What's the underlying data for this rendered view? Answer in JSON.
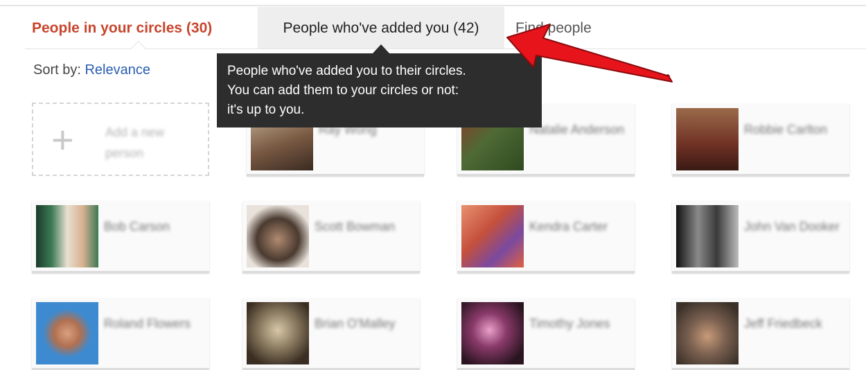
{
  "tabs": [
    {
      "label": "People in your circles (30)"
    },
    {
      "label": "People who've added you (42)"
    },
    {
      "label": "Find people"
    }
  ],
  "sort": {
    "label": "Sort by:",
    "value": "Relevance"
  },
  "tooltip": {
    "line1": "People who've added you to their circles.",
    "line2": "You can add them to your circles or not:",
    "line3": "it's up to you."
  },
  "add_person": {
    "label": "Add a new person"
  },
  "people": [
    {
      "name": "Ray Wong",
      "avatar_color": "#7a5a43"
    },
    {
      "name": "Natalie Anderson",
      "avatar_color": "#4f6a35"
    },
    {
      "name": "Robbie Carlton",
      "avatar_color": "#6e3024"
    },
    {
      "name": "Bob Carson",
      "avatar_color": "#3d7a55"
    },
    {
      "name": "Scott Bowman",
      "avatar_color": "#4a3a30"
    },
    {
      "name": "Kendra Carter",
      "avatar_color": "#c5503c"
    },
    {
      "name": "John Van Dooker",
      "avatar_color": "#3a3a3a"
    },
    {
      "name": "Roland Flowers",
      "avatar_color": "#3d8ad0"
    },
    {
      "name": "Brian O'Malley",
      "avatar_color": "#6a5a46"
    },
    {
      "name": "Timothy Jones",
      "avatar_color": "#3a1e28"
    },
    {
      "name": "Jeff Friedbeck",
      "avatar_color": "#5a5048"
    }
  ],
  "colors": {
    "accent": "#c8452c",
    "link": "#2a5db0",
    "tooltip_bg": "#2d2d2d",
    "arrow": "#e8141b"
  }
}
